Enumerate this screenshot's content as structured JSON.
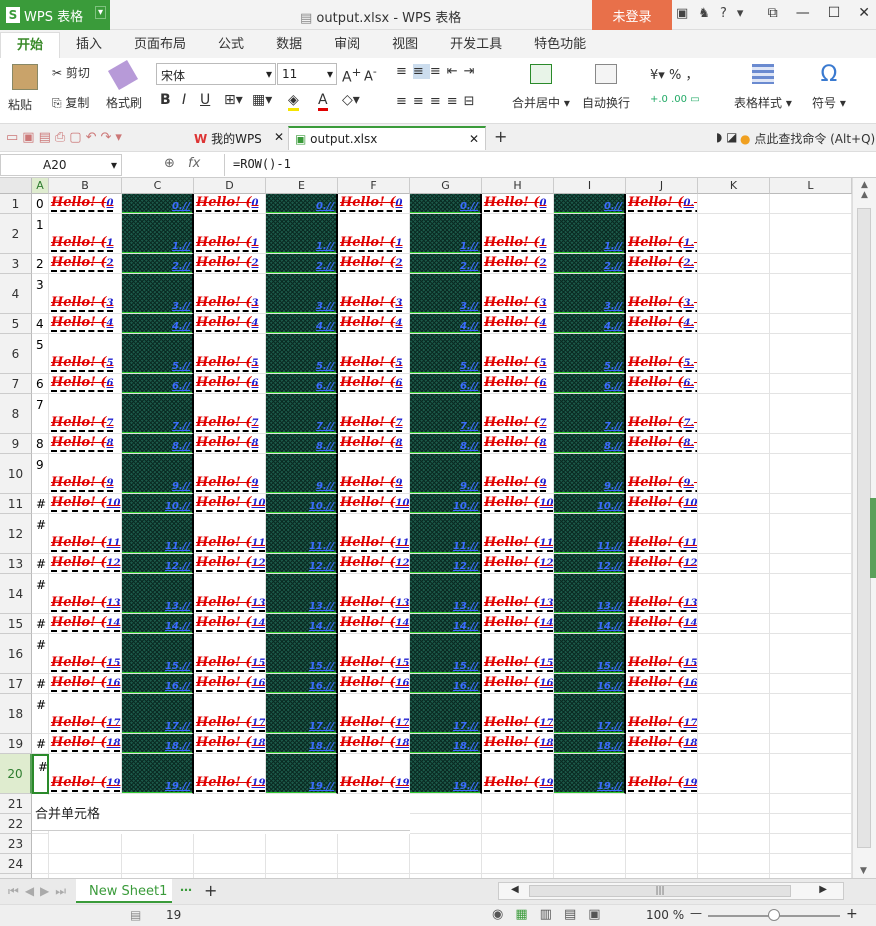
{
  "app": {
    "name": "WPS 表格",
    "window_title": "output.xlsx - WPS 表格",
    "login": "未登录"
  },
  "menu": [
    "开始",
    "插入",
    "页面布局",
    "公式",
    "数据",
    "审阅",
    "视图",
    "开发工具",
    "特色功能"
  ],
  "ribbon": {
    "paste": "粘贴",
    "cut": "剪切",
    "copy": "复制",
    "format_painter": "格式刷",
    "font_name": "宋体",
    "font_size": "11",
    "merge_center": "合并居中",
    "wrap_text": "自动换行",
    "table_style": "表格样式",
    "symbol": "符号",
    "percent": "%",
    "comma": "，"
  },
  "tabs": {
    "home": "我的WPS",
    "file": "output.xlsx",
    "search": "点此查找命令 (Alt+Q)"
  },
  "formula": {
    "cell_ref": "A20",
    "fx": "fx",
    "content": "=ROW()-1"
  },
  "columns": [
    "A",
    "B",
    "C",
    "D",
    "E",
    "F",
    "G",
    "H",
    "I",
    "J",
    "K",
    "L"
  ],
  "rows": [
    "1",
    "2",
    "3",
    "4",
    "5",
    "6",
    "7",
    "8",
    "9",
    "10",
    "11",
    "12",
    "13",
    "14",
    "15",
    "16",
    "17",
    "18",
    "19",
    "20",
    "21",
    "22",
    "23",
    "24",
    "25"
  ],
  "a_values": [
    "0",
    "1",
    "2",
    "3",
    "4",
    "5",
    "6",
    "7",
    "8",
    "9",
    "#",
    "#",
    "#",
    "#",
    "#",
    "#",
    "#",
    "#",
    "#",
    "#"
  ],
  "hello_text": "Hello! (",
  "b_nums": [
    "0",
    "1",
    "2",
    "3",
    "4",
    "5",
    "6",
    "7",
    "8",
    "9",
    "10",
    "11",
    "12",
    "13",
    "14",
    "15",
    "16",
    "17",
    "18",
    "19"
  ],
  "j_nums": [
    "0.",
    "1.",
    "2.",
    "3.",
    "4.",
    "5.",
    "6.",
    "7.",
    "8.",
    "9.",
    "10.",
    "11.",
    "12.",
    "13.",
    "14.",
    "15.",
    "16.",
    "17.",
    "18.",
    "19."
  ],
  "dark_nums": [
    "0.//",
    "1.//",
    "2.//",
    "3.//",
    "4.//",
    "5.//",
    "6.//",
    "7.//",
    "8.//",
    "9.//",
    "10.//",
    "11.//",
    "12.//",
    "13.//",
    "14.//",
    "15.//",
    "16.//",
    "17.//",
    "18.//",
    "19.//"
  ],
  "merged_text": "合并单元格",
  "sheet": {
    "name": "New Sheet1"
  },
  "status": {
    "count": "19",
    "zoom": "100 %"
  }
}
